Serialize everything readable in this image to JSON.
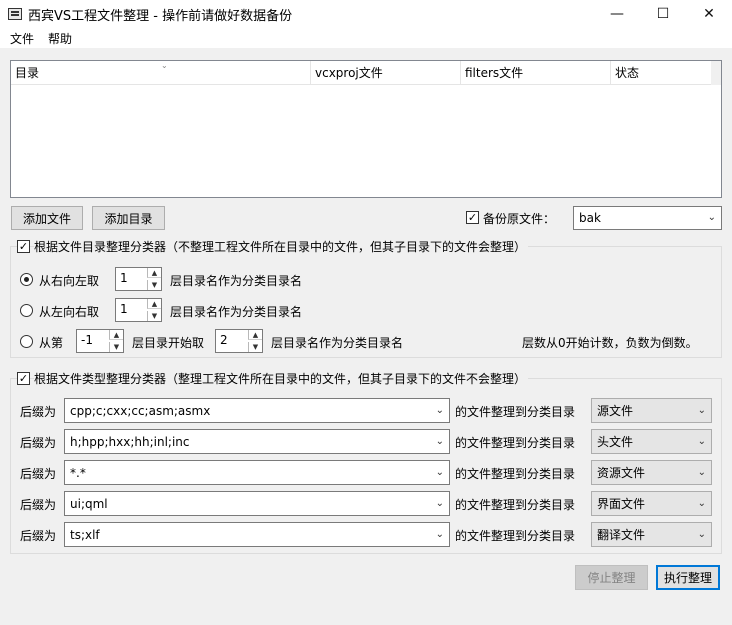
{
  "window": {
    "title": "西宾VS工程文件整理 - 操作前请做好数据备份",
    "minimize_glyph": "—",
    "maximize_glyph": "☐",
    "close_glyph": "✕"
  },
  "menu": {
    "file": "文件",
    "help": "帮助"
  },
  "list": {
    "columns": [
      "目录",
      "vcxproj文件",
      "filters文件",
      "状态"
    ]
  },
  "buttons": {
    "add_file": "添加文件",
    "add_dir": "添加目录",
    "stop": "停止整理",
    "run": "执行整理"
  },
  "backup": {
    "checked": true,
    "label": "备份原文件：",
    "value": "bak"
  },
  "dir_group": {
    "checked": true,
    "label": "根据文件目录整理分类器（不整理工程文件所在目录中的文件，但其子目录下的文件会整理）",
    "options": [
      {
        "selected": true,
        "label": "从右向左取",
        "value": "1",
        "suffix": "层目录名作为分类目录名"
      },
      {
        "selected": false,
        "label": "从左向右取",
        "value": "1",
        "suffix": "层目录名作为分类目录名"
      }
    ],
    "range": {
      "selected": false,
      "label": "从第",
      "start": "-1",
      "mid": "层目录开始取",
      "count": "2",
      "suffix": "层目录名作为分类目录名",
      "note": "层数从0开始计数，负数为倒数。"
    }
  },
  "type_group": {
    "checked": true,
    "label": "根据文件类型整理分类器（整理工程文件所在目录中的文件，但其子目录下的文件不会整理）",
    "prefix_label": "后缀为",
    "mid_label": "的文件整理到分类目录",
    "rows": [
      {
        "pattern": "cpp;c;cxx;cc;asm;asmx",
        "target": "源文件"
      },
      {
        "pattern": "h;hpp;hxx;hh;inl;inc",
        "target": "头文件"
      },
      {
        "pattern": "*.*",
        "target": "资源文件"
      },
      {
        "pattern": "ui;qml",
        "target": "界面文件"
      },
      {
        "pattern": "ts;xlf",
        "target": "翻译文件"
      }
    ]
  },
  "glyphs": {
    "check": "✓",
    "combo_arrow": "⌄",
    "spin_up": "▲",
    "spin_down": "▼",
    "sort": "⌄"
  }
}
